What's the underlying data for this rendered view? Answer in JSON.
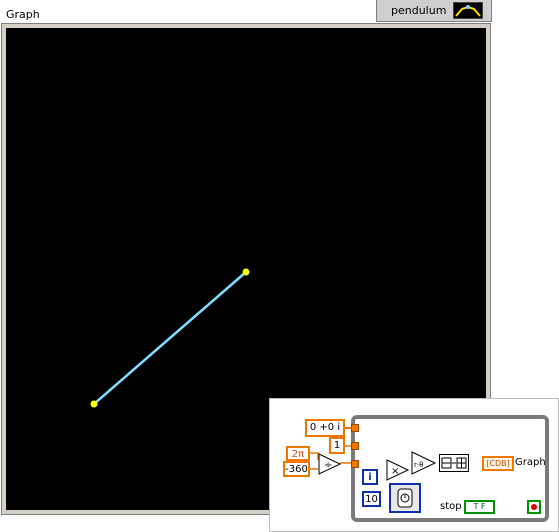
{
  "window": {
    "graph_label": "Graph",
    "tab_label": "pendulum",
    "tab_icon": "pendulum-thumbnail-icon"
  },
  "graph": {
    "background": "#000000",
    "line_color": "#7fdcff",
    "marker_color": "#ffff00"
  },
  "block_diagram": {
    "complex_const": "0 +0 i",
    "one_const": "1",
    "two_pi_const": "2π",
    "neg360_const": "-360",
    "iteration_label": "i",
    "wait_const": "10",
    "graph_indicator_label": "Graph",
    "graph_indicator_type": "[CDB]",
    "stop_label": "stop",
    "bool_const": "T F",
    "divide_symbol": "÷",
    "multiply_symbol": "×",
    "polar_symbol": "r·θ"
  }
}
